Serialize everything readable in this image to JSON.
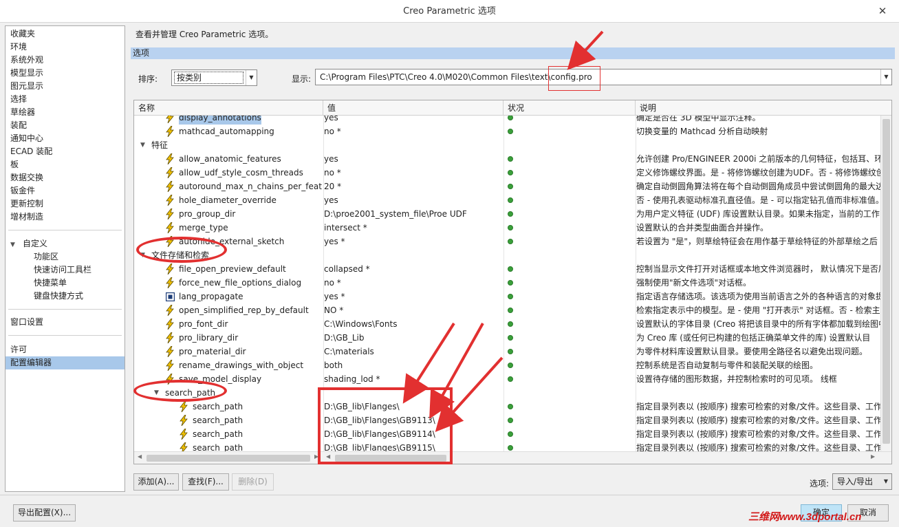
{
  "window": {
    "title": "Creo Parametric 选项",
    "close_glyph": "✕"
  },
  "sidebar": {
    "items": [
      {
        "label": "收藏夹"
      },
      {
        "label": "环境"
      },
      {
        "label": "系统外观"
      },
      {
        "label": "模型显示"
      },
      {
        "label": "图元显示"
      },
      {
        "label": "选择"
      },
      {
        "label": "草绘器"
      },
      {
        "label": "装配"
      },
      {
        "label": "通知中心"
      },
      {
        "label": "ECAD 装配"
      },
      {
        "label": "板"
      },
      {
        "label": "数据交换"
      },
      {
        "label": "钣金件"
      },
      {
        "label": "更新控制"
      },
      {
        "label": "增材制造"
      }
    ],
    "customize": {
      "label": "自定义",
      "children": [
        {
          "label": "功能区"
        },
        {
          "label": "快速访问工具栏"
        },
        {
          "label": "快捷菜单"
        },
        {
          "label": "键盘快捷方式"
        }
      ]
    },
    "window_settings": "窗口设置",
    "license": "许可",
    "config_editor": "配置编辑器"
  },
  "main": {
    "heading": "查看并管理 Creo Parametric 选项。",
    "section_label": "选项",
    "sort_label": "排序:",
    "sort_value": "按类别",
    "show_label": "显示:",
    "show_path": "C:\\Program Files\\PTC\\Creo 4.0\\M020\\Common Files\\text\\config.pro"
  },
  "table": {
    "columns": [
      "名称",
      "值",
      "状况",
      "说明"
    ],
    "rows": [
      {
        "type": "option",
        "icon": "bolt-icon",
        "indent": 1,
        "name": "display_annotations",
        "value": "yes",
        "desc": "确定是否在 3D 模型中显示注释。",
        "highlight": true
      },
      {
        "type": "option",
        "icon": "bolt-icon",
        "indent": 1,
        "name": "mathcad_automapping",
        "value": "no *",
        "desc": "切换变量的 Mathcad 分析自动映射"
      },
      {
        "type": "group",
        "indent": 0,
        "name": "特征"
      },
      {
        "type": "option",
        "icon": "bolt-icon",
        "indent": 1,
        "name": "allow_anatomic_features",
        "value": "yes",
        "desc": "允许创建 Pro/ENGINEER 2000i 之前版本的几何特征，包括耳、环"
      },
      {
        "type": "option",
        "icon": "bolt-icon",
        "indent": 1,
        "name": "allow_udf_style_cosm_threads",
        "value": "no *",
        "desc": "定义修饰螺纹界面。是 - 将修饰螺纹创建为UDF。否 - 将修饰螺纹创"
      },
      {
        "type": "option",
        "icon": "bolt-icon",
        "indent": 1,
        "name": "autoround_max_n_chains_per_feat",
        "value": "20 *",
        "desc": "确定自动倒圆角算法将在每个自动倒圆角成员中尝试倒圆角的最大边"
      },
      {
        "type": "option",
        "icon": "bolt-icon",
        "indent": 1,
        "name": "hole_diameter_override",
        "value": "yes",
        "desc": "否 - 使用孔表驱动标准孔直径值。是 - 可以指定钻孔值而非标准值。"
      },
      {
        "type": "option",
        "icon": "bolt-icon",
        "indent": 1,
        "name": "pro_group_dir",
        "value": "D:\\proe2001_system_file\\Proe UDF",
        "desc": "为用户定义特征 (UDF) 库设置默认目录。如果未指定，当前的工作目"
      },
      {
        "type": "option",
        "icon": "bolt-icon",
        "indent": 1,
        "name": "merge_type",
        "value": "intersect *",
        "desc": "设置默认的合并类型曲面合并操作。"
      },
      {
        "type": "option",
        "icon": "bolt-icon",
        "indent": 1,
        "name": "autohide_external_sketch",
        "value": "yes *",
        "desc": "若设置为 \"是\"，则草绘特征会在用作基于草绘特征的外部草绘之后"
      },
      {
        "type": "group",
        "indent": 0,
        "name": "文件存储和检索"
      },
      {
        "type": "option",
        "icon": "bolt-icon",
        "indent": 1,
        "name": "file_open_preview_default",
        "value": "collapsed *",
        "desc": "控制当显示文件打开对话框或本地文件浏览器时， 默认情况下是否展"
      },
      {
        "type": "option",
        "icon": "bolt-icon",
        "indent": 1,
        "name": "force_new_file_options_dialog",
        "value": "no *",
        "desc": "强制使用\"新文件选项\"对话框。"
      },
      {
        "type": "option",
        "icon": "book-icon",
        "indent": 1,
        "name": "lang_propagate",
        "value": "yes *",
        "desc": "指定语言存储选项。该选项为使用当前语言之外的各种语言的对象提"
      },
      {
        "type": "option",
        "icon": "bolt-icon",
        "indent": 1,
        "name": "open_simplified_rep_by_default",
        "value": "NO *",
        "desc": "检索指定表示中的模型。是 - 使用 \"打开表示\" 对话框。否 - 检索主"
      },
      {
        "type": "option",
        "icon": "bolt-icon",
        "indent": 1,
        "name": "pro_font_dir",
        "value": "C:\\Windows\\Fonts",
        "desc": "设置默认的字体目录 (Creo 将把该目录中的所有字体都加载到绘图中"
      },
      {
        "type": "option",
        "icon": "bolt-icon",
        "indent": 1,
        "name": "pro_library_dir",
        "value": "D:\\GB_Lib",
        "desc": "为 Creo 库 (或任何已构建的包括正确菜单文件的库) 设置默认目"
      },
      {
        "type": "option",
        "icon": "bolt-icon",
        "indent": 1,
        "name": "pro_material_dir",
        "value": "C:\\materials",
        "desc": "为零件材料库设置默认目录。要使用全路径名以避免出现问题。"
      },
      {
        "type": "option",
        "icon": "bolt-icon",
        "indent": 1,
        "name": "rename_drawings_with_object",
        "value": "both",
        "desc": "控制系统是否自动复制与零件和装配关联的绘图。"
      },
      {
        "type": "option",
        "icon": "bolt-icon",
        "indent": 1,
        "name": "save_model_display",
        "value": "shading_lod *",
        "desc": "                              设置待存储的图形数据，并控制检索时的可见项。 线框"
      },
      {
        "type": "group",
        "indent": 1,
        "name": "search_path"
      },
      {
        "type": "option",
        "icon": "bolt-icon",
        "indent": 2,
        "name": "search_path",
        "value": "D:\\GB_lib\\Flanges\\",
        "desc": "指定目录列表以 (按顺序) 搜索可检索的对象/文件。这些目录、工作"
      },
      {
        "type": "option",
        "icon": "bolt-icon",
        "indent": 2,
        "name": "search_path",
        "value": "D:\\GB_lib\\Flanges\\GB9113\\",
        "desc": "指定目录列表以 (按顺序) 搜索可检索的对象/文件。这些目录、工作"
      },
      {
        "type": "option",
        "icon": "bolt-icon",
        "indent": 2,
        "name": "search_path",
        "value": "D:\\GB_lib\\Flanges\\GB9114\\",
        "desc": "指定目录列表以 (按顺序) 搜索可检索的对象/文件。这些目录、工作"
      },
      {
        "type": "option",
        "icon": "bolt-icon",
        "indent": 2,
        "name": "search_path",
        "value": "D:\\GB_lib\\Flanges\\GB9115\\",
        "desc": "指定目录列表以 (按顺序) 搜索可检索的对象/文件。这些目录、工作"
      }
    ]
  },
  "buttons": {
    "add": "添加(A)...",
    "find": "查找(F)...",
    "delete": "删除(D)",
    "options_label": "选项:",
    "import_export": "导入/导出",
    "export_config": "导出配置(X)...",
    "ok": "确定",
    "cancel": "取消"
  },
  "watermark": "三维网www.3dportal.cn",
  "colors": {
    "selection": "#a8c8ea",
    "section_bar": "#b9d2f0",
    "status_ok": "#3aa03a",
    "annotation": "#e23030",
    "bolt": "#e8b800"
  }
}
